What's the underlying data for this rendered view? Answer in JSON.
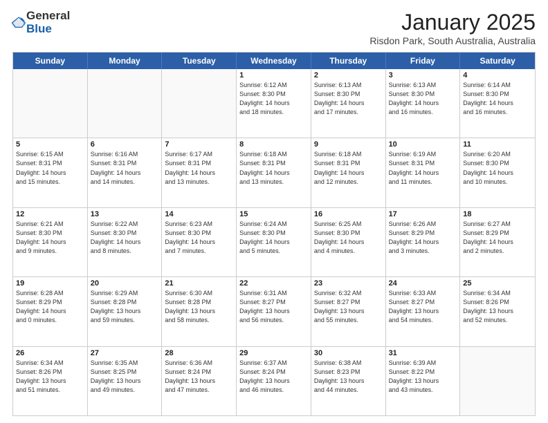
{
  "logo": {
    "general": "General",
    "blue": "Blue"
  },
  "header": {
    "title": "January 2025",
    "location": "Risdon Park, South Australia, Australia"
  },
  "weekdays": [
    "Sunday",
    "Monday",
    "Tuesday",
    "Wednesday",
    "Thursday",
    "Friday",
    "Saturday"
  ],
  "rows": [
    [
      {
        "day": "",
        "info": ""
      },
      {
        "day": "",
        "info": ""
      },
      {
        "day": "",
        "info": ""
      },
      {
        "day": "1",
        "info": "Sunrise: 6:12 AM\nSunset: 8:30 PM\nDaylight: 14 hours\nand 18 minutes."
      },
      {
        "day": "2",
        "info": "Sunrise: 6:13 AM\nSunset: 8:30 PM\nDaylight: 14 hours\nand 17 minutes."
      },
      {
        "day": "3",
        "info": "Sunrise: 6:13 AM\nSunset: 8:30 PM\nDaylight: 14 hours\nand 16 minutes."
      },
      {
        "day": "4",
        "info": "Sunrise: 6:14 AM\nSunset: 8:30 PM\nDaylight: 14 hours\nand 16 minutes."
      }
    ],
    [
      {
        "day": "5",
        "info": "Sunrise: 6:15 AM\nSunset: 8:31 PM\nDaylight: 14 hours\nand 15 minutes."
      },
      {
        "day": "6",
        "info": "Sunrise: 6:16 AM\nSunset: 8:31 PM\nDaylight: 14 hours\nand 14 minutes."
      },
      {
        "day": "7",
        "info": "Sunrise: 6:17 AM\nSunset: 8:31 PM\nDaylight: 14 hours\nand 13 minutes."
      },
      {
        "day": "8",
        "info": "Sunrise: 6:18 AM\nSunset: 8:31 PM\nDaylight: 14 hours\nand 13 minutes."
      },
      {
        "day": "9",
        "info": "Sunrise: 6:18 AM\nSunset: 8:31 PM\nDaylight: 14 hours\nand 12 minutes."
      },
      {
        "day": "10",
        "info": "Sunrise: 6:19 AM\nSunset: 8:31 PM\nDaylight: 14 hours\nand 11 minutes."
      },
      {
        "day": "11",
        "info": "Sunrise: 6:20 AM\nSunset: 8:30 PM\nDaylight: 14 hours\nand 10 minutes."
      }
    ],
    [
      {
        "day": "12",
        "info": "Sunrise: 6:21 AM\nSunset: 8:30 PM\nDaylight: 14 hours\nand 9 minutes."
      },
      {
        "day": "13",
        "info": "Sunrise: 6:22 AM\nSunset: 8:30 PM\nDaylight: 14 hours\nand 8 minutes."
      },
      {
        "day": "14",
        "info": "Sunrise: 6:23 AM\nSunset: 8:30 PM\nDaylight: 14 hours\nand 7 minutes."
      },
      {
        "day": "15",
        "info": "Sunrise: 6:24 AM\nSunset: 8:30 PM\nDaylight: 14 hours\nand 5 minutes."
      },
      {
        "day": "16",
        "info": "Sunrise: 6:25 AM\nSunset: 8:30 PM\nDaylight: 14 hours\nand 4 minutes."
      },
      {
        "day": "17",
        "info": "Sunrise: 6:26 AM\nSunset: 8:29 PM\nDaylight: 14 hours\nand 3 minutes."
      },
      {
        "day": "18",
        "info": "Sunrise: 6:27 AM\nSunset: 8:29 PM\nDaylight: 14 hours\nand 2 minutes."
      }
    ],
    [
      {
        "day": "19",
        "info": "Sunrise: 6:28 AM\nSunset: 8:29 PM\nDaylight: 14 hours\nand 0 minutes."
      },
      {
        "day": "20",
        "info": "Sunrise: 6:29 AM\nSunset: 8:28 PM\nDaylight: 13 hours\nand 59 minutes."
      },
      {
        "day": "21",
        "info": "Sunrise: 6:30 AM\nSunset: 8:28 PM\nDaylight: 13 hours\nand 58 minutes."
      },
      {
        "day": "22",
        "info": "Sunrise: 6:31 AM\nSunset: 8:27 PM\nDaylight: 13 hours\nand 56 minutes."
      },
      {
        "day": "23",
        "info": "Sunrise: 6:32 AM\nSunset: 8:27 PM\nDaylight: 13 hours\nand 55 minutes."
      },
      {
        "day": "24",
        "info": "Sunrise: 6:33 AM\nSunset: 8:27 PM\nDaylight: 13 hours\nand 54 minutes."
      },
      {
        "day": "25",
        "info": "Sunrise: 6:34 AM\nSunset: 8:26 PM\nDaylight: 13 hours\nand 52 minutes."
      }
    ],
    [
      {
        "day": "26",
        "info": "Sunrise: 6:34 AM\nSunset: 8:26 PM\nDaylight: 13 hours\nand 51 minutes."
      },
      {
        "day": "27",
        "info": "Sunrise: 6:35 AM\nSunset: 8:25 PM\nDaylight: 13 hours\nand 49 minutes."
      },
      {
        "day": "28",
        "info": "Sunrise: 6:36 AM\nSunset: 8:24 PM\nDaylight: 13 hours\nand 47 minutes."
      },
      {
        "day": "29",
        "info": "Sunrise: 6:37 AM\nSunset: 8:24 PM\nDaylight: 13 hours\nand 46 minutes."
      },
      {
        "day": "30",
        "info": "Sunrise: 6:38 AM\nSunset: 8:23 PM\nDaylight: 13 hours\nand 44 minutes."
      },
      {
        "day": "31",
        "info": "Sunrise: 6:39 AM\nSunset: 8:22 PM\nDaylight: 13 hours\nand 43 minutes."
      },
      {
        "day": "",
        "info": ""
      }
    ]
  ]
}
